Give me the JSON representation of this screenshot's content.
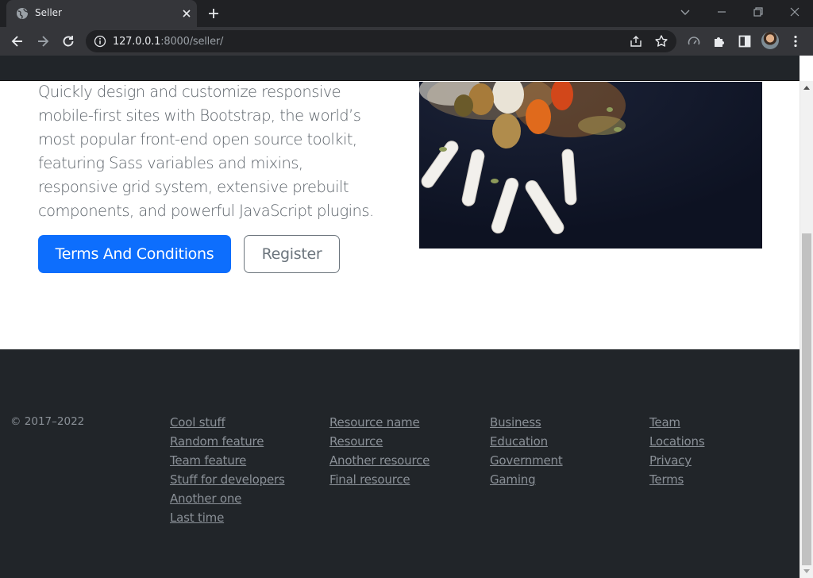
{
  "browser": {
    "tab_title": "Seller",
    "url_host": "127.0.0.1",
    "url_path": ":8000/seller/"
  },
  "hero": {
    "lead_text": "Quickly design and customize responsive mobile-first sites with Bootstrap, the world’s most popular front-end open source toolkit, featuring Sass variables and mixins, responsive grid system, extensive prebuilt components, and powerful JavaScript plugins.",
    "primary_button": "Terms And Conditions",
    "secondary_button": "Register"
  },
  "footer": {
    "copyright": "© 2017–2022",
    "columns": [
      {
        "links": [
          "Cool stuff",
          "Random feature",
          "Team feature",
          "Stuff for developers",
          "Another one",
          "Last time"
        ]
      },
      {
        "links": [
          "Resource name",
          "Resource",
          "Another resource",
          "Final resource"
        ]
      },
      {
        "links": [
          "Business",
          "Education",
          "Government",
          "Gaming"
        ]
      },
      {
        "links": [
          "Team",
          "Locations",
          "Privacy",
          "Terms"
        ]
      }
    ]
  },
  "colors": {
    "primary": "#0d6efd",
    "dark": "#212529",
    "muted_text": "#6c757d"
  }
}
